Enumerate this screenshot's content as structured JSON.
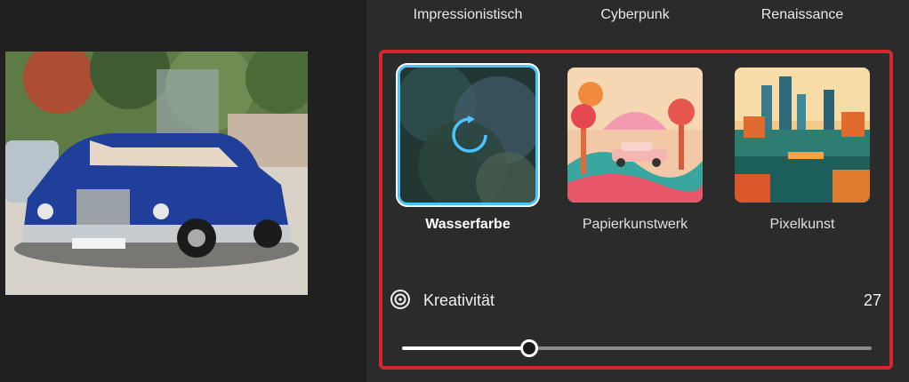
{
  "styles_top": [
    "Impressionistisch",
    "Cyberpunk",
    "Renaissance"
  ],
  "thumbnails": [
    {
      "label": "Wasserfarbe",
      "selected": true,
      "state": "loading"
    },
    {
      "label": "Papierkunstwerk",
      "selected": false
    },
    {
      "label": "Pixelkunst",
      "selected": false
    }
  ],
  "creativity": {
    "label": "Kreativität",
    "value": "27",
    "fraction": 0.27
  },
  "icons": {
    "loading": "refresh-icon",
    "creativity": "target-icon"
  },
  "colors": {
    "accent": "#4cc2ff",
    "highlight": "#d9262c"
  }
}
